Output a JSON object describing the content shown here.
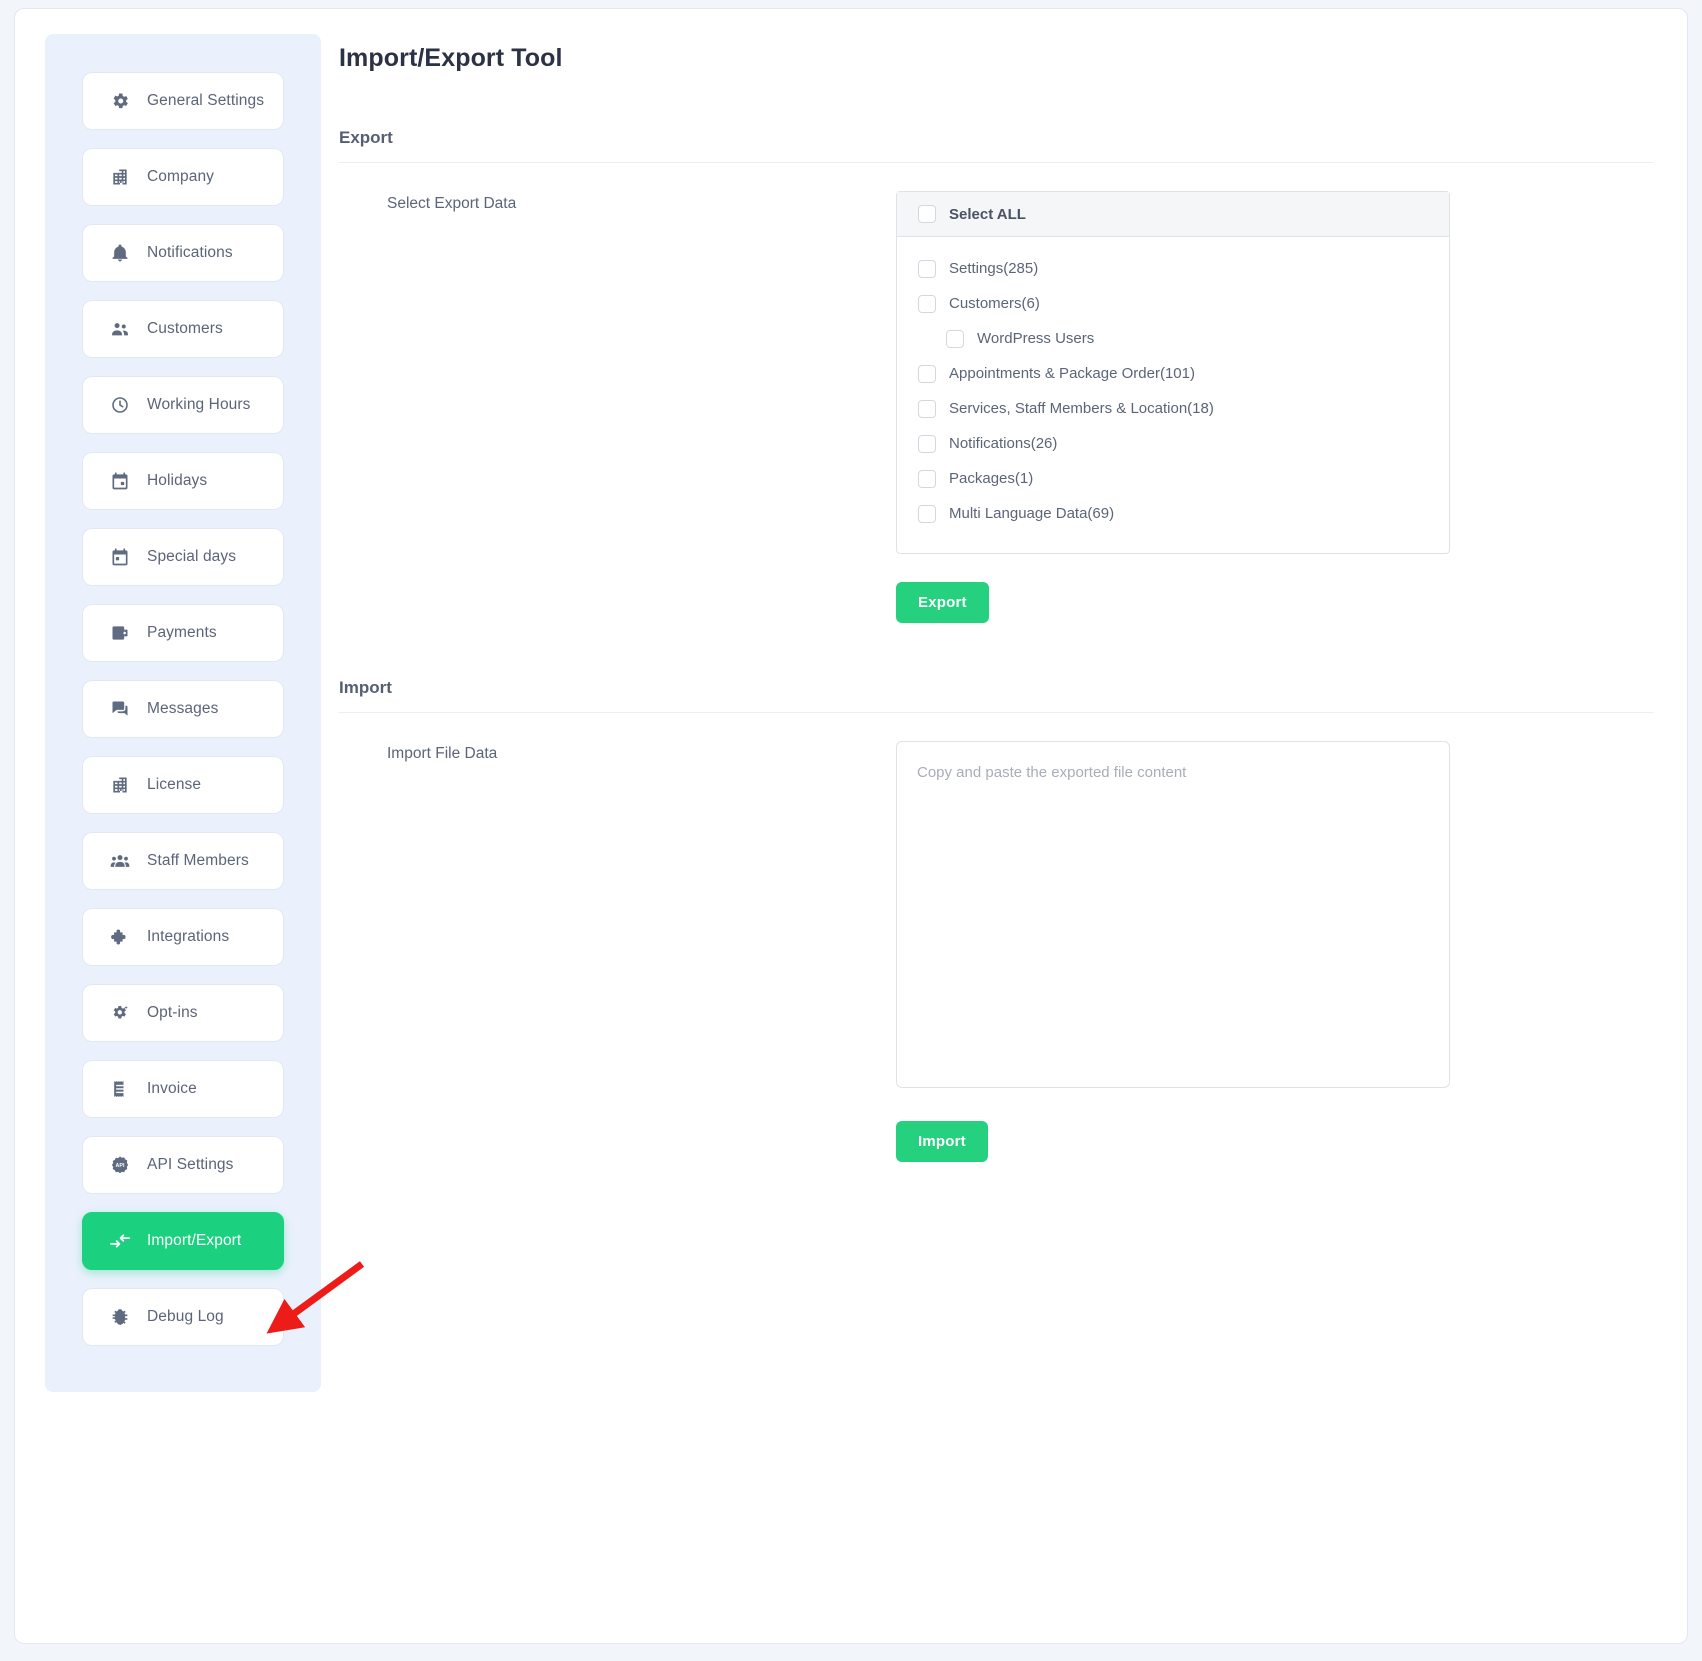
{
  "sidebar": {
    "items": [
      {
        "label": "General Settings",
        "icon": "gear-icon",
        "active": false
      },
      {
        "label": "Company",
        "icon": "building-icon",
        "active": false
      },
      {
        "label": "Notifications",
        "icon": "bell-icon",
        "active": false
      },
      {
        "label": "Customers",
        "icon": "people-icon",
        "active": false
      },
      {
        "label": "Working Hours",
        "icon": "clock-icon",
        "active": false
      },
      {
        "label": "Holidays",
        "icon": "calendar-icon",
        "active": false
      },
      {
        "label": "Special days",
        "icon": "calendar-event-icon",
        "active": false
      },
      {
        "label": "Payments",
        "icon": "wallet-icon",
        "active": false
      },
      {
        "label": "Messages",
        "icon": "chat-icon",
        "active": false
      },
      {
        "label": "License",
        "icon": "building-icon",
        "active": false
      },
      {
        "label": "Staff Members",
        "icon": "group-icon",
        "active": false
      },
      {
        "label": "Integrations",
        "icon": "puzzle-icon",
        "active": false
      },
      {
        "label": "Opt-ins",
        "icon": "gear-sparkle-icon",
        "active": false
      },
      {
        "label": "Invoice",
        "icon": "invoice-icon",
        "active": false
      },
      {
        "label": "API Settings",
        "icon": "api-icon",
        "active": false
      },
      {
        "label": "Import/Export",
        "icon": "import-export-icon",
        "active": true
      },
      {
        "label": "Debug Log",
        "icon": "bug-icon",
        "active": false
      }
    ]
  },
  "main": {
    "page_title": "Import/Export Tool",
    "export": {
      "section_title": "Export",
      "field_label": "Select Export Data",
      "select_all_label": "Select ALL",
      "options": [
        {
          "label": "Settings(285)",
          "indent": false,
          "checked": false
        },
        {
          "label": "Customers(6)",
          "indent": false,
          "checked": false
        },
        {
          "label": "WordPress Users",
          "indent": true,
          "checked": false
        },
        {
          "label": "Appointments & Package Order(101)",
          "indent": false,
          "checked": false
        },
        {
          "label": "Services, Staff Members & Location(18)",
          "indent": false,
          "checked": false
        },
        {
          "label": "Notifications(26)",
          "indent": false,
          "checked": false
        },
        {
          "label": "Packages(1)",
          "indent": false,
          "checked": false
        },
        {
          "label": "Multi Language Data(69)",
          "indent": false,
          "checked": false
        }
      ],
      "button_label": "Export"
    },
    "import": {
      "section_title": "Import",
      "field_label": "Import File Data",
      "textarea_placeholder": "Copy and paste the exported file content",
      "textarea_value": "",
      "button_label": "Import"
    }
  },
  "annotation": {
    "arrow_color": "#ee1c19",
    "points_to": "Import/Export"
  },
  "colors": {
    "accent_green": "#25d07f",
    "sidebar_bg": "#eaf1fd",
    "page_bg": "#f2f5fa",
    "text": "#5b6578"
  }
}
